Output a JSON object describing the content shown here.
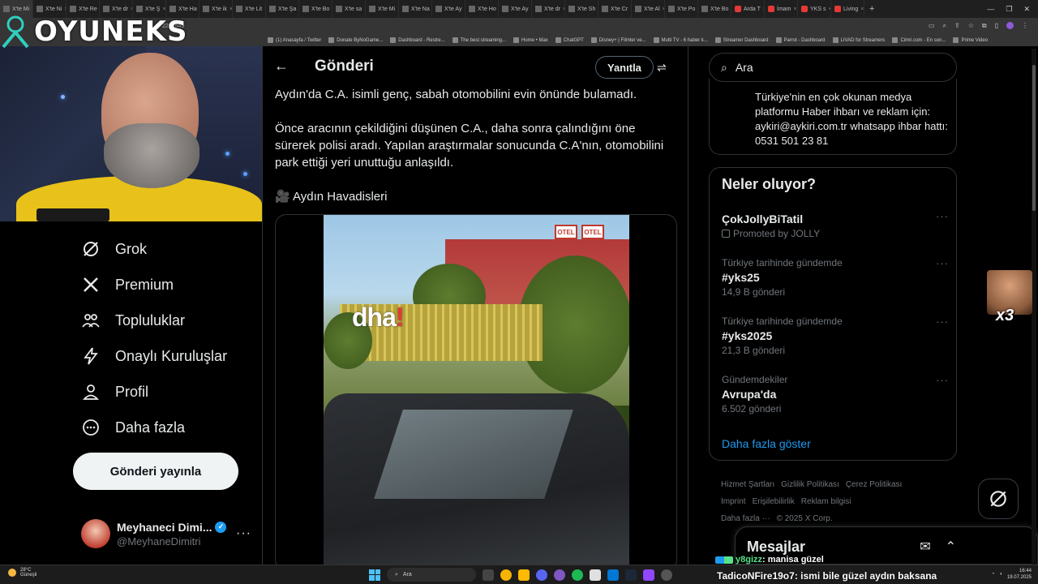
{
  "browser": {
    "tabs": [
      {
        "label": "X'te Mi"
      },
      {
        "label": "X'te Ni"
      },
      {
        "label": "X'te Re"
      },
      {
        "label": "X'te dr"
      },
      {
        "label": "X'te Ş"
      },
      {
        "label": "X'te Ha"
      },
      {
        "label": "X'te ik"
      },
      {
        "label": "X'te Lit"
      },
      {
        "label": "X'te Şa"
      },
      {
        "label": "X'te Bo"
      },
      {
        "label": "X'te sa"
      },
      {
        "label": "X'te Mi"
      },
      {
        "label": "X'te Na"
      },
      {
        "label": "X'te Ay"
      },
      {
        "label": "X'te Ho"
      },
      {
        "label": "X'te Ay"
      },
      {
        "label": "X'te dr"
      },
      {
        "label": "X'te Sh"
      },
      {
        "label": "X'te Cr"
      },
      {
        "label": "X'te Al"
      },
      {
        "label": "X'te Po"
      },
      {
        "label": "X'te Bo"
      },
      {
        "label": "Arda T"
      },
      {
        "label": "İmam"
      },
      {
        "label": "YKS s"
      },
      {
        "label": "Living"
      }
    ],
    "tab_count_shown": "26",
    "addr_fragment": "2257645",
    "bookmarks": [
      "(1) Anasayfa / Twitter",
      "Donate ByNoGame...",
      "Dashboard - Restre...",
      "The best streaming...",
      "Home • Max",
      "ChatGPT",
      "Disney+ | Filmler ve...",
      "Multi TV - 6 haber k...",
      "Streamer Dashboard",
      "Parrot - Dashboard",
      "LIVAD for Streamers",
      "Cimri.com - En son...",
      "Prime Video"
    ]
  },
  "overlay": {
    "logo_text": "OYUNEKS",
    "emote_text": "x3"
  },
  "sidebar": {
    "items": [
      {
        "label": "Grok",
        "icon": "grok-icon"
      },
      {
        "label": "Premium",
        "icon": "x-logo-icon"
      },
      {
        "label": "Topluluklar",
        "icon": "communities-icon"
      },
      {
        "label": "Onaylı Kuruluşlar",
        "icon": "lightning-icon"
      },
      {
        "label": "Profil",
        "icon": "profile-icon"
      },
      {
        "label": "Daha fazla",
        "icon": "more-circle-icon"
      }
    ],
    "post_button": "Gönderi yayınla",
    "profile": {
      "name": "Meyhaneci Dimi...",
      "handle": "@MeyhaneDimitri"
    }
  },
  "main": {
    "header_title": "Gönderi",
    "reply_label": "Yanıtla",
    "paragraphs": [
      "Aydın'da C.A. isimli genç, sabah otomobilini evin önünde bulamadı.",
      "Önce aracının çekildiğini düşünen C.A., daha sonra çalındığını öne sürerek polisi aradı. Yapılan araştırmalar sonucunda C.A'nın, otomobilini park ettiği yeri unuttuğu anlaşıldı.",
      "🎥 Aydın Havadisleri"
    ],
    "video": {
      "watermark_left": "dha",
      "watermark_mark": "!",
      "sign1": "OTEL",
      "sign2": "OTEL"
    }
  },
  "right": {
    "search_placeholder": "Ara",
    "bio": "Türkiye'nin en çok okunan medya platformu Haber ihbarı ve reklam için: aykiri@aykiri.com.tr whatsapp ihbar hattı: 0531 501 23 81",
    "trends_title": "Neler oluyor?",
    "trends": [
      {
        "meta": "",
        "name": "ÇokJollyBiTatil",
        "count": "Promoted by JOLLY"
      },
      {
        "meta": "Türkiye tarihinde gündemde",
        "name": "#yks25",
        "count": "14,9 B gönderi"
      },
      {
        "meta": "Türkiye tarihinde gündemde",
        "name": "#yks2025",
        "count": "21,3 B gönderi"
      },
      {
        "meta": "Gündemdekiler",
        "name": "Avrupa'da",
        "count": "6.502 gönderi"
      }
    ],
    "show_more": "Daha fazla göster",
    "footer_links": [
      "Hizmet Şartları",
      "Gizlilik Politikası",
      "Çerez Politikası",
      "Imprint",
      "Erişilebilirlik",
      "Reklam bilgisi",
      "Daha fazla ···",
      "© 2025 X Corp."
    ],
    "messages_title": "Mesajlar"
  },
  "chat": {
    "line1_user": "y8gizz",
    "line1_text": ": manisa güzel",
    "line2_user": "TadicoNFire19o7",
    "line2_text": ": ismi bile güzel aydın baksana"
  },
  "taskbar": {
    "weather_temp": "28°C",
    "weather_desc": "Güneşli",
    "search": "Ara",
    "time": "16:44",
    "date": "19.07.2025"
  }
}
